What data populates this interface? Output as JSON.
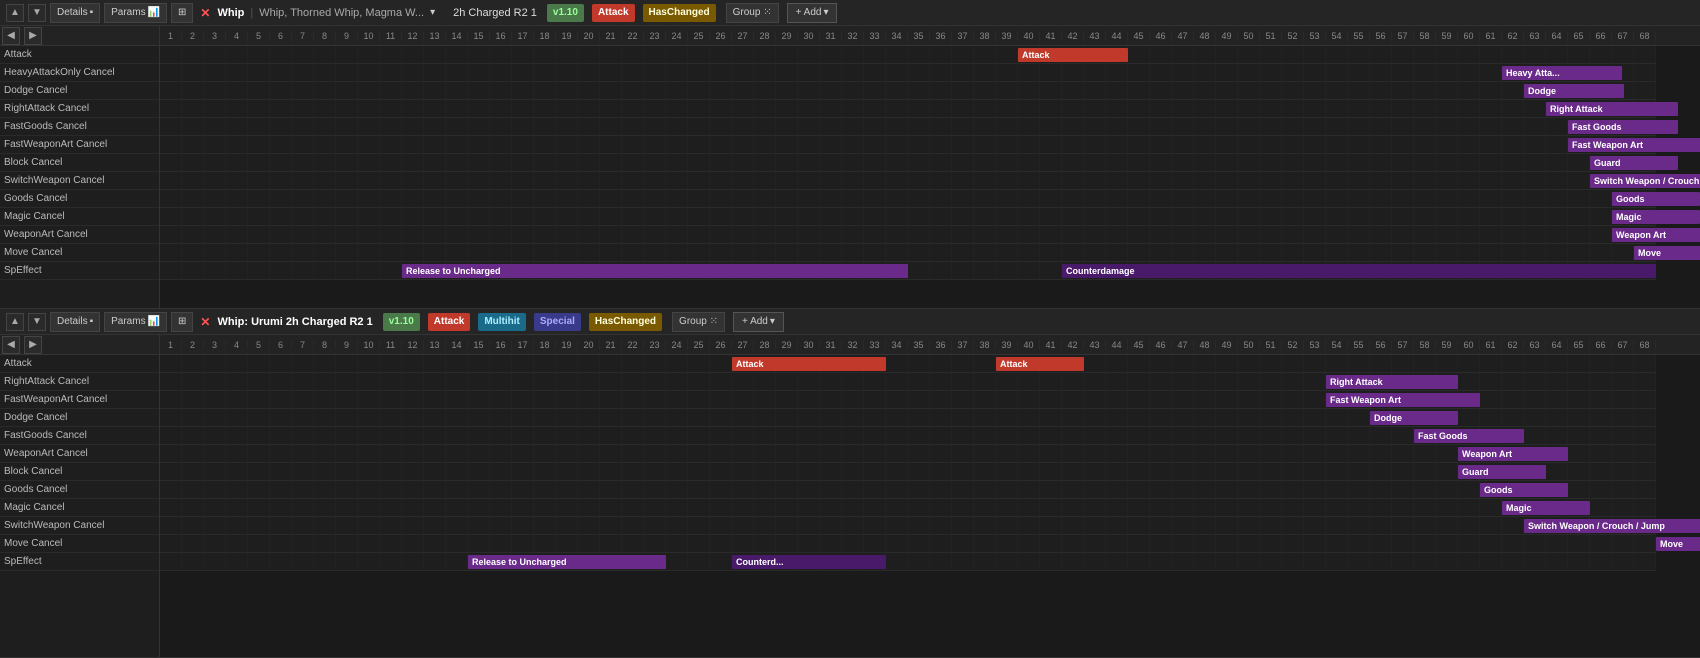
{
  "panels": [
    {
      "id": "panel1",
      "toolbar": {
        "up_label": "▲",
        "down_label": "▼",
        "details_label": "Details",
        "params_label": "Params",
        "grid_label": "⊞",
        "close_label": "✕",
        "title": "Whip",
        "subtitle": "Whip, Thorned Whip, Magma W...",
        "dropdown_label": "▾",
        "charge_label": "2h Charged R2 1",
        "version_label": "v1.10",
        "attack_label": "Attack",
        "haschanged_label": "HasChanged",
        "group_label": "Group ⁙",
        "add_label": "+ Add",
        "add_dropdown": "▾"
      },
      "row_labels": [
        "Attack",
        "HeavyAttackOnly Cancel",
        "Dodge Cancel",
        "RightAttack Cancel",
        "FastGoods Cancel",
        "FastWeaponArt Cancel",
        "Block Cancel",
        "SwitchWeapon Cancel",
        "Goods Cancel",
        "Magic Cancel",
        "WeaponArt Cancel",
        "Move Cancel",
        "SpEffect"
      ],
      "bars": [
        {
          "row": 0,
          "start": 40,
          "width": 5,
          "label": "Attack",
          "color": "red"
        },
        {
          "row": 1,
          "start": 62,
          "width": 5,
          "label": "Heavy Atta...",
          "color": "purple"
        },
        {
          "row": 2,
          "start": 63,
          "width": 3,
          "label": "Dodge",
          "color": "purple"
        },
        {
          "row": 3,
          "start": 64,
          "width": 3,
          "label": "Right Attack",
          "color": "purple"
        },
        {
          "row": 4,
          "start": 65,
          "width": 3,
          "label": "Fast Goods",
          "color": "purple"
        },
        {
          "row": 5,
          "start": 65,
          "width": 4,
          "label": "Fast Weapon Art",
          "color": "purple"
        },
        {
          "row": 6,
          "start": 66,
          "width": 3,
          "label": "Guard",
          "color": "purple"
        },
        {
          "row": 7,
          "start": 66,
          "width": 5,
          "label": "Switch Weapon / Crouch / Jump",
          "color": "purple"
        },
        {
          "row": 8,
          "start": 67,
          "width": 3,
          "label": "Goods",
          "color": "purple"
        },
        {
          "row": 9,
          "start": 68,
          "width": 3,
          "label": "Magic",
          "color": "purple"
        },
        {
          "row": 10,
          "start": 68,
          "width": 4,
          "label": "Weapon Art",
          "color": "purple"
        },
        {
          "row": 11,
          "start": 69,
          "width": 3,
          "label": "Move",
          "color": "purple"
        },
        {
          "row": 12,
          "start": 11,
          "width": 23,
          "label": "Release to Uncharged",
          "color": "purple"
        },
        {
          "row": 12,
          "start": 41,
          "width": 30,
          "label": "Counterdamage",
          "color": "darkpurple"
        }
      ]
    },
    {
      "id": "panel2",
      "toolbar": {
        "up_label": "▲",
        "down_label": "▼",
        "details_label": "Details",
        "params_label": "Params",
        "grid_label": "⊞",
        "close_label": "✕",
        "title": "Whip: Urumi 2h Charged R2 1",
        "version_label": "v1.10",
        "attack_label": "Attack",
        "multihit_label": "Multihit",
        "special_label": "Special",
        "haschanged_label": "HasChanged",
        "group_label": "Group ⁙",
        "add_label": "+ Add",
        "add_dropdown": "▾"
      },
      "row_labels": [
        "Attack",
        "RightAttack Cancel",
        "FastWeaponArt Cancel",
        "Dodge Cancel",
        "FastGoods Cancel",
        "WeaponArt Cancel",
        "Block Cancel",
        "Goods Cancel",
        "Magic Cancel",
        "SwitchWeapon Cancel",
        "Move Cancel",
        "SpEffect"
      ],
      "bars": [
        {
          "row": 0,
          "start": 27,
          "width": 7,
          "label": "Attack",
          "color": "red"
        },
        {
          "row": 0,
          "start": 39,
          "width": 4,
          "label": "Attack",
          "color": "red"
        },
        {
          "row": 1,
          "start": 54,
          "width": 4,
          "label": "Right Attack",
          "color": "purple"
        },
        {
          "row": 2,
          "start": 54,
          "width": 4,
          "label": "Fast Weapon Art",
          "color": "purple"
        },
        {
          "row": 3,
          "start": 55,
          "width": 3,
          "label": "Dodge",
          "color": "purple"
        },
        {
          "row": 4,
          "start": 57,
          "width": 3,
          "label": "Fast Goods",
          "color": "purple"
        },
        {
          "row": 5,
          "start": 59,
          "width": 4,
          "label": "Weapon Art",
          "color": "purple"
        },
        {
          "row": 6,
          "start": 59,
          "width": 3,
          "label": "Guard",
          "color": "purple"
        },
        {
          "row": 7,
          "start": 60,
          "width": 3,
          "label": "Goods",
          "color": "purple"
        },
        {
          "row": 8,
          "start": 61,
          "width": 3,
          "label": "Magic",
          "color": "purple"
        },
        {
          "row": 9,
          "start": 62,
          "width": 5,
          "label": "Switch Weapon / Crouch / Jump",
          "color": "purple"
        },
        {
          "row": 10,
          "start": 69,
          "width": 3,
          "label": "Move",
          "color": "purple"
        },
        {
          "row": 11,
          "start": 14,
          "width": 9,
          "label": "Release to Uncharged",
          "color": "purple"
        },
        {
          "row": 11,
          "start": 26,
          "width": 7,
          "label": "Counterd...",
          "color": "darkpurple"
        }
      ]
    }
  ],
  "frame_count": 68,
  "frame_width": 22,
  "colors": {
    "red_bar": "#c0392b",
    "purple_bar": "#6a2a8a",
    "dark_purple_bar": "#4a1a6a",
    "bg_dark": "#1a1a1a",
    "bg_medium": "#1e1e1e",
    "bg_toolbar": "#252525",
    "text_primary": "#cccccc",
    "accent_green": "#4a7a4a"
  }
}
